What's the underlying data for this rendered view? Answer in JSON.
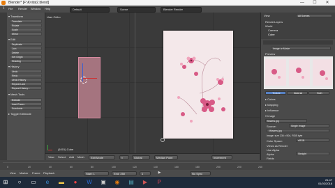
{
  "window": {
    "title": "Blender* [F:\\Kvitat2.blend]",
    "min": "—",
    "max": "☐",
    "close": "✕"
  },
  "info_header": {
    "menus": [
      "File",
      "Render",
      "Window",
      "Help"
    ],
    "layout": "Default",
    "scene": "Scene",
    "engine": "Blender Render"
  },
  "tool_shelf": {
    "transform_header": "▾ Transform",
    "transform_buttons": [
      "Translate",
      "Rotate",
      "Scale",
      "Mirror"
    ],
    "edit_header": "▾ Edit",
    "edit_buttons": [
      "Duplicate",
      "Join",
      "Delete",
      "Set Origin",
      "Shading"
    ],
    "history_header": "▾ History",
    "history_buttons": [
      "Undo",
      "Redo",
      "Undo History",
      "Repeat Last",
      "Repeat History..."
    ],
    "mesh_header": "▾ Mesh Tools",
    "bottom_buttons": [
      "Extrude",
      "Inset Faces",
      "Subdivide"
    ],
    "toggle_label": "▸ Toggle Editmode"
  },
  "viewport": {
    "view_label": "User Ortho",
    "object_label": "(1001) Cube"
  },
  "v3d_header": {
    "menus": [
      "View",
      "Select",
      "Add",
      "Mesh"
    ],
    "mode": "Edit Mode",
    "shading": "Global",
    "pivot": "Median Point",
    "snap": "Increment"
  },
  "timeline": {
    "menus": [
      "View",
      "Marker",
      "Frame",
      "Playback"
    ],
    "start_label": "Start: 1",
    "end_label": "End: 250",
    "current_frame": "1",
    "sync": "No Sync"
  },
  "outliner": {
    "search_placeholder": "All Scenes",
    "items": [
      "RenderLayers",
      "World",
      "Camera",
      "Cube",
      "Lamp"
    ],
    "header_menu": "View"
  },
  "properties": {
    "texture_name": "Image or Movie",
    "preview_label": "Preview",
    "tabs": [
      "Texture",
      "Material",
      "Both"
    ],
    "colors_label": "▸ Colors",
    "mapping_label": "▸ Mapping",
    "influence_label": "▸ Influence",
    "image_label": "▾ Image",
    "image_name": "flowers.jpg",
    "source_label": "Source:",
    "source_value": "Single Image",
    "path_value": "//flowers.jpg",
    "info_line": "Image: size 236 x 504, RGB byte",
    "color_space_label": "Color Space:",
    "color_space_value": "sRGB",
    "views_as_label": "Views as Render",
    "use_alpha_label": "Use Alpha",
    "alpha_label": "Alpha:",
    "alpha_value": "Straight",
    "fields_label": "Fields"
  },
  "taskbar": {
    "icons": [
      "start-icon",
      "search-icon",
      "task-view-icon",
      "edge-icon",
      "explorer-icon",
      "chrome-icon",
      "word-icon",
      "store-icon",
      "blender-icon",
      "photos-icon",
      "media-icon",
      "ppt-icon"
    ],
    "time": "21:47",
    "date": "01/02/2018"
  }
}
